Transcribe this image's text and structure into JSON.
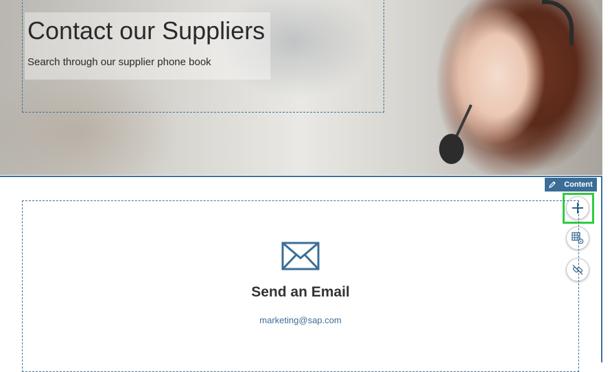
{
  "hero": {
    "title": "Contact our Suppliers",
    "subtitle": "Search through our supplier phone book"
  },
  "toolbar": {
    "edit_icon": "pencil-icon",
    "content_label": "Content",
    "add_icon": "plus-icon",
    "grid_icon": "table-settings-icon",
    "link_icon": "unlink-icon"
  },
  "section": {
    "icon": "envelope-icon",
    "title": "Send an Email",
    "email": "marketing@sap.com"
  },
  "colors": {
    "accent": "#3b6d96",
    "highlight": "#2ecc40",
    "text": "#333333"
  }
}
